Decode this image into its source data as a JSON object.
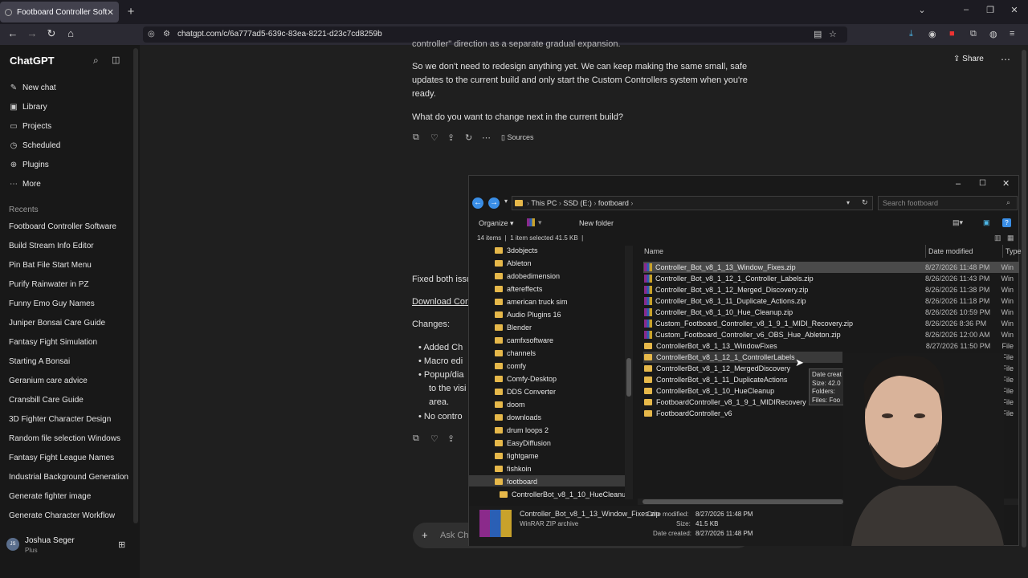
{
  "browser": {
    "tab_title": "Footboard Controller Software",
    "url": "chatgpt.com/c/6a777ad5-639c-83ea-8221-d23c7cd8259b"
  },
  "sidebar": {
    "brand": "ChatGPT",
    "nav": [
      {
        "label": "New chat",
        "icon": "edit-icon"
      },
      {
        "label": "Library",
        "icon": "library-icon"
      },
      {
        "label": "Projects",
        "icon": "folder-icon"
      },
      {
        "label": "Scheduled",
        "icon": "clock-icon"
      },
      {
        "label": "Plugins",
        "icon": "plugin-icon"
      },
      {
        "label": "More",
        "icon": "more-icon"
      }
    ],
    "recents_title": "Recents",
    "recents": [
      "Footboard Controller Software",
      "Build Stream Info Editor",
      "Pin Bat File Start Menu",
      "Purify Rainwater in PZ",
      "Funny Emo Guy Names",
      "Juniper Bonsai Care Guide",
      "Fantasy Fight Simulation",
      "Starting A Bonsai",
      "Geranium care advice",
      "Cransbill Care Guide",
      "3D Fighter Character Design",
      "Random file selection Windows",
      "Fantasy Fight League Names",
      "Industrial Background Generation",
      "Generate fighter image",
      "Generate Character Workflow"
    ],
    "user": {
      "initials": "JS",
      "name": "Joshua Seger",
      "plan": "Plus"
    }
  },
  "chat": {
    "share": "Share",
    "top_partial": "controller\" direction as a separate gradual expansion.",
    "para1": "So we don't need to redesign anything yet. We can keep making the same small, safe",
    "para2": "updates to the current build and only start the Custom Controllers system when you're",
    "para3": "ready.",
    "question": "What do you want to change next in the current build?",
    "sources": "Sources",
    "fixed": "Fixed both issu",
    "download": "Download Con",
    "changes": "Changes:",
    "bullets": [
      "Added Ch",
      "Macro edi",
      "Popup/dia",
      "to the visi",
      "area.",
      "No contro"
    ],
    "composer_placeholder": "Ask Cha"
  },
  "explorer": {
    "path": [
      "This PC",
      "SSD (E:)",
      "footboard"
    ],
    "search_placeholder": "Search footboard",
    "organize": "Organize",
    "new_folder": "New folder",
    "status_items": "14 items",
    "status_selected": "1 item selected  41.5 KB",
    "col_name": "Name",
    "col_date": "Date modified",
    "col_type": "Type",
    "files": [
      {
        "name": "Controller_Bot_v8_1_13_Window_Fixes.zip",
        "date": "8/27/2026 11:48 PM",
        "type": "Win",
        "kind": "zip"
      },
      {
        "name": "Controller_Bot_v8_1_12_1_Controller_Labels.zip",
        "date": "8/26/2026 11:43 PM",
        "type": "Win",
        "kind": "zip"
      },
      {
        "name": "Controller_Bot_v8_1_12_Merged_Discovery.zip",
        "date": "8/26/2026 11:38 PM",
        "type": "Win",
        "kind": "zip"
      },
      {
        "name": "Controller_Bot_v8_1_11_Duplicate_Actions.zip",
        "date": "8/26/2026 11:18 PM",
        "type": "Win",
        "kind": "zip"
      },
      {
        "name": "Controller_Bot_v8_1_10_Hue_Cleanup.zip",
        "date": "8/26/2026 10:59 PM",
        "type": "Win",
        "kind": "zip"
      },
      {
        "name": "Custom_Footboard_Controller_v8_1_9_1_MIDI_Recovery.zip",
        "date": "8/26/2026 8:36 PM",
        "type": "Win",
        "kind": "zip"
      },
      {
        "name": "Custom_Footboard_Controller_v6_OBS_Hue_Ableton.zip",
        "date": "8/26/2026 12:00 AM",
        "type": "Win",
        "kind": "zip"
      },
      {
        "name": "ControllerBot_v8_1_13_WindowFixes",
        "date": "8/27/2026 11:50 PM",
        "type": "File",
        "kind": "folder"
      },
      {
        "name": "ControllerBot_v8_1_12_1_ControllerLabels",
        "date": "8/26/2026 11:45 PM",
        "type": "File",
        "kind": "folder"
      },
      {
        "name": "ControllerBot_v8_1_12_MergedDiscovery",
        "date": "",
        "type": "File",
        "kind": "folder"
      },
      {
        "name": "ControllerBot_v8_1_11_DuplicateActions",
        "date": "",
        "type": "File",
        "kind": "folder"
      },
      {
        "name": "ControllerBot_v8_1_10_HueCleanup",
        "date": "",
        "type": "File",
        "kind": "folder"
      },
      {
        "name": "FootboardController_v8_1_9_1_MIDIRecovery",
        "date": "",
        "type": "File",
        "kind": "folder"
      },
      {
        "name": "FootboardController_v6",
        "date": "",
        "type": "File",
        "kind": "folder"
      }
    ],
    "tree": [
      "3dobjects",
      "Ableton",
      "adobedimension",
      "aftereffects",
      "american truck sim",
      "Audio Plugins 16",
      "Blender",
      "camfxsoftware",
      "channels",
      "comfy",
      "Comfy-Desktop",
      "DDS Converter",
      "doom",
      "downloads",
      "drum loops 2",
      "EasyDiffusion",
      "fightgame",
      "fishkoin",
      "footboard",
      "ControllerBot_v8_1_10_HueCleanup"
    ],
    "tooltip": [
      "Date creat",
      "Size: 42.0",
      "Folders: ",
      "Files: Foo"
    ],
    "details": {
      "name": "Controller_Bot_v8_1_13_Window_Fixes.zip",
      "type": "WinRAR ZIP archive",
      "modified_label": "Date modified:",
      "modified": "8/27/2026 11:48 PM",
      "size_label": "Size:",
      "size": "41.5 KB",
      "created_label": "Date created:",
      "created": "8/27/2026 11:48 PM"
    }
  }
}
